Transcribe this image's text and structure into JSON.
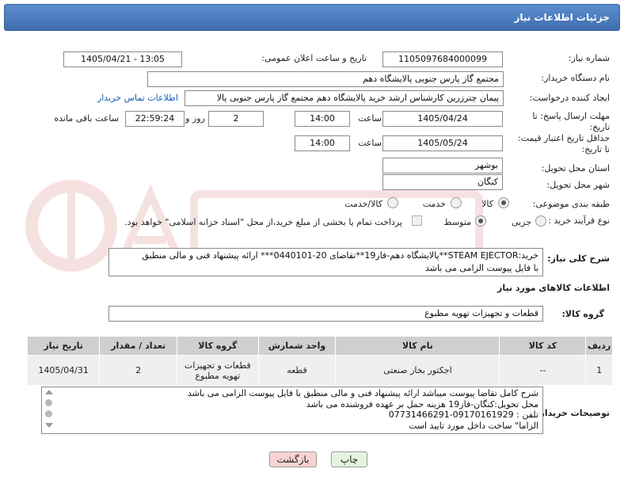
{
  "header": {
    "title": "جزئیات اطلاعات نیاز"
  },
  "fields": {
    "need_number_label": "شماره نیاز:",
    "need_number": "1105097684000099",
    "announce_label": "تاریخ و ساعت اعلان عمومی:",
    "announce_value": "1405/04/21 - 13:05",
    "buyer_org_label": "نام دستگاه خریدار:",
    "buyer_org": "مجتمع گاز پارس جنوبی  پالایشگاه دهم",
    "creator_label": "ایجاد کننده درخواست:",
    "creator": "پیمان چترزرین کارشناس ارشد خرید پالایشگاه دهم مجتمع گاز پارس جنوبی  پالا",
    "contact_link": "اطلاعات تماس خریدار",
    "deadline_label_1": "مهلت ارسال پاسخ: تا",
    "deadline_label_2": "تاریخ:",
    "deadline_date": "1405/04/24",
    "hour_label": "ساعت",
    "deadline_time": "14:00",
    "days_value": "2",
    "days_label": "روز و",
    "remaining_time": "22:59:24",
    "remaining_label": "ساعت باقی مانده",
    "price_label_1": "حداقل تاریخ اعتبار قیمت:",
    "price_label_2": "تا تاریخ:",
    "price_date": "1405/05/24",
    "price_time": "14:00",
    "province_label": "استان محل تحویل:",
    "province": "بوشهر",
    "city_label": "شهر محل تحویل:",
    "city": "کنگان",
    "category_label": "طبقه بندی موضوعی:",
    "cat_goods": "کالا",
    "cat_service": "خدمت",
    "cat_goods_service": "کالا/خدمت",
    "process_label": "نوع فرآیند خرید :",
    "proc_minor": "جزیی",
    "proc_medium": "متوسط",
    "treasury_note": "پرداخت تمام یا بخشی از مبلغ خرید،از محل \"اسناد خزانه اسلامی\" خواهد بود."
  },
  "description": {
    "label": "شرح کلی نیاز:",
    "line1": "خرید:STEAM EJECTOR**پالایشگاه دهم-فاز19**تقاضای 20-0440101*** ارائه پیشنهاد فنی و مالی منطبق",
    "line2": "با فایل پیوست الزامی می باشد"
  },
  "goods_section": {
    "title": "اطلاعات کالاهای مورد نیاز",
    "group_label": "گروه کالا:",
    "group_value": "قطعات و تجهیزات تهویه مطبوع"
  },
  "table": {
    "headers": [
      "ردیف",
      "کد کالا",
      "نام کالا",
      "واحد شمارش",
      "گروه کالا",
      "تعداد / مقدار",
      "تاریخ نیاز"
    ],
    "rows": [
      [
        "1",
        "--",
        "اجکتور بخار صنعتی",
        "قطعه",
        "قطعات و تجهیزات تهویه مطبوع",
        "2",
        "1405/04/31"
      ]
    ]
  },
  "buyer_notes": {
    "label": "توضیحات خریدار:",
    "lines": [
      "شرح کامل تقاضا پیوست میباشد ارائه پیشنهاد فنی و مالی منطبق با فایل پیوست الزامی می باشد",
      "محل تحویل:کنگان-فاز19 هزینه حمل بر عهده فروشنده می باشد",
      "تلفن : 09170161929-07731466291",
      "الزاما\" ساخت داخل مورد تایید است"
    ]
  },
  "buttons": {
    "print": "چاپ",
    "back": "بازگشت"
  },
  "colors": {
    "header_bg": "#4f81bd",
    "back_button": "#f8d3d3",
    "print_button": "#e4f5df",
    "link": "#1a5fb4"
  }
}
